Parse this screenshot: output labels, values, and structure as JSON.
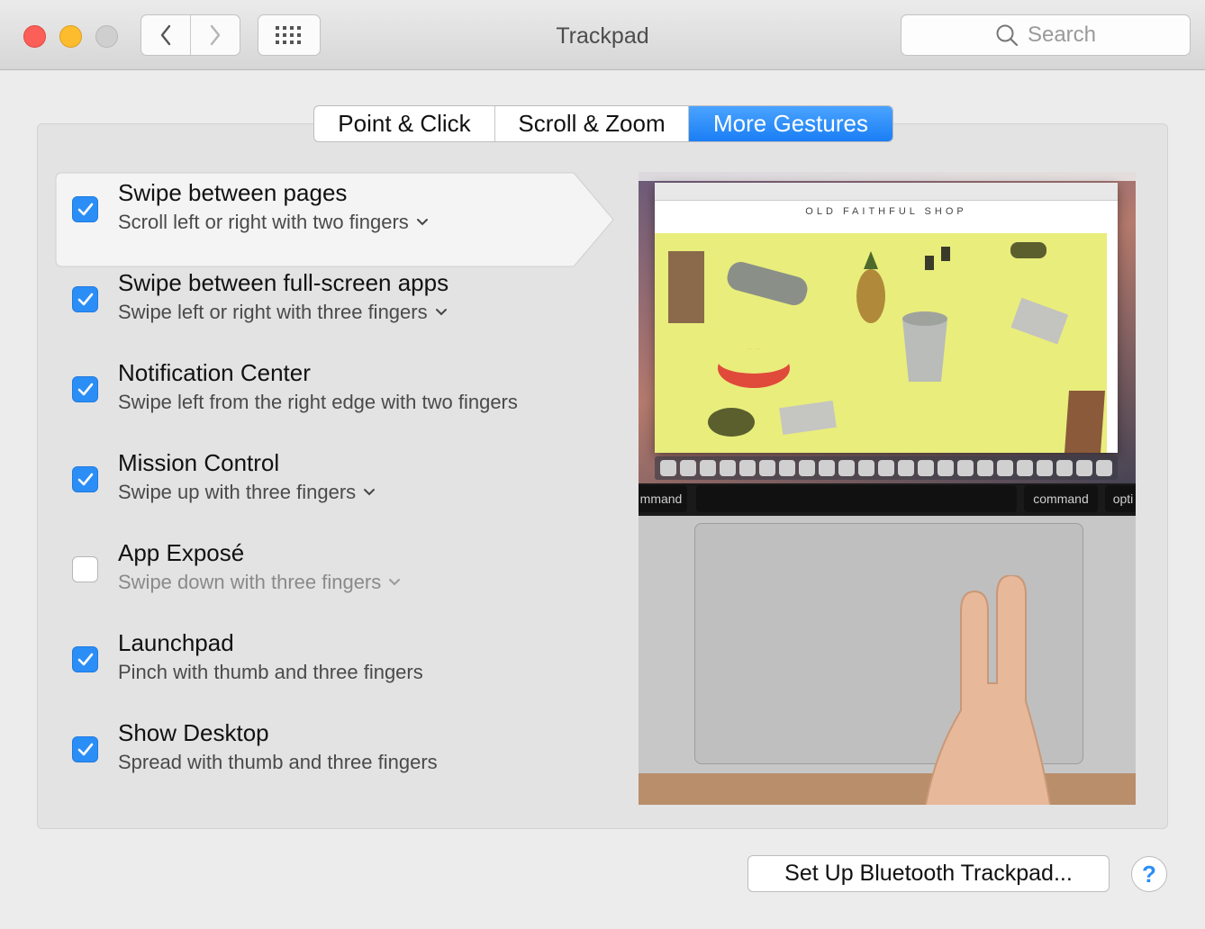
{
  "window": {
    "title": "Trackpad"
  },
  "toolbar": {
    "search_placeholder": "Search",
    "back_icon": "chevron-left-icon",
    "forward_icon": "chevron-right-icon",
    "grid_icon": "show-all-grid-icon"
  },
  "tabs": [
    {
      "label": "Point & Click",
      "active": false
    },
    {
      "label": "Scroll & Zoom",
      "active": false
    },
    {
      "label": "More Gestures",
      "active": true
    }
  ],
  "gestures": [
    {
      "title": "Swipe between pages",
      "subtitle": "Scroll left or right with two fingers",
      "checked": true,
      "has_menu": true,
      "selected": true
    },
    {
      "title": "Swipe between full-screen apps",
      "subtitle": "Swipe left or right with three fingers",
      "checked": true,
      "has_menu": true
    },
    {
      "title": "Notification Center",
      "subtitle": "Swipe left from the right edge with two fingers",
      "checked": true,
      "has_menu": false
    },
    {
      "title": "Mission Control",
      "subtitle": "Swipe up with three fingers",
      "checked": true,
      "has_menu": true
    },
    {
      "title": "App Exposé",
      "subtitle": "Swipe down with three fingers",
      "checked": false,
      "has_menu": true
    },
    {
      "title": "Launchpad",
      "subtitle": "Pinch with thumb and three fingers",
      "checked": true,
      "has_menu": false
    },
    {
      "title": "Show Desktop",
      "subtitle": "Spread with thumb and three fingers",
      "checked": true,
      "has_menu": false
    }
  ],
  "preview": {
    "shop_title": "OLD FAITHFUL SHOP",
    "keys": [
      "mmand",
      "command",
      "opti"
    ]
  },
  "footer": {
    "setup_label": "Set Up Bluetooth Trackpad...",
    "help_label": "?"
  },
  "colors": {
    "accent": "#2b8ef7",
    "close": "#fc5f57",
    "minimize": "#fdbc2e",
    "zoom_disabled": "#cfcfcf"
  }
}
